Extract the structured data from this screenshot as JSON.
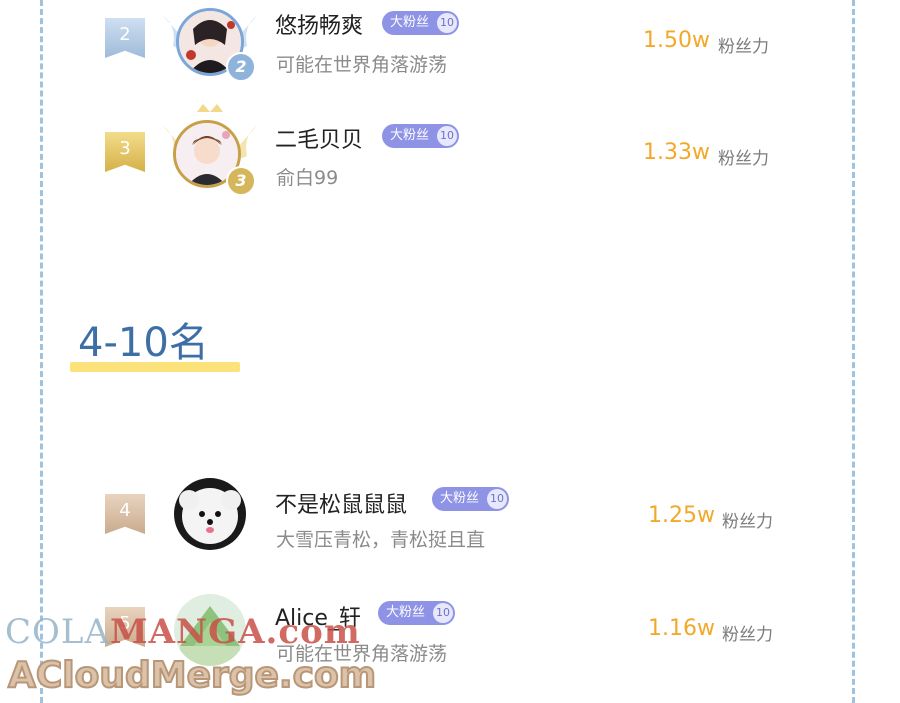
{
  "top_ranks": [
    {
      "rank": "2",
      "medal": "2",
      "name": "悠扬畅爽",
      "fan_tag": "大粉丝",
      "fan_level": "10",
      "bio": "可能在世界角落游荡",
      "score": "1.50w",
      "score_unit": "粉丝力"
    },
    {
      "rank": "3",
      "medal": "3",
      "name": "二毛贝贝",
      "fan_tag": "大粉丝",
      "fan_level": "10",
      "bio": "俞白99",
      "score": "1.33w",
      "score_unit": "粉丝力"
    }
  ],
  "section": {
    "title": "4-10名"
  },
  "other_ranks": [
    {
      "rank": "4",
      "name": "不是松鼠鼠鼠",
      "fan_tag": "大粉丝",
      "fan_level": "10",
      "bio": "大雪压青松，青松挺且直",
      "score": "1.25w",
      "score_unit": "粉丝力"
    },
    {
      "rank": "5",
      "name": "Alice_轩",
      "fan_tag": "大粉丝",
      "fan_level": "10",
      "bio": "可能在世界角落游荡",
      "score": "1.16w",
      "score_unit": "粉丝力"
    }
  ],
  "watermark": {
    "line1_a": "COLA",
    "line1_b": "MANGA",
    "line1_c": ".com",
    "line2": "ACloudMerge.com"
  },
  "colors": {
    "score": "#f2a829",
    "fan_tag": "#8e93e6",
    "section_title": "#3d6fa6",
    "underline": "#fbe27a",
    "border_dash": "#9fc3df"
  }
}
